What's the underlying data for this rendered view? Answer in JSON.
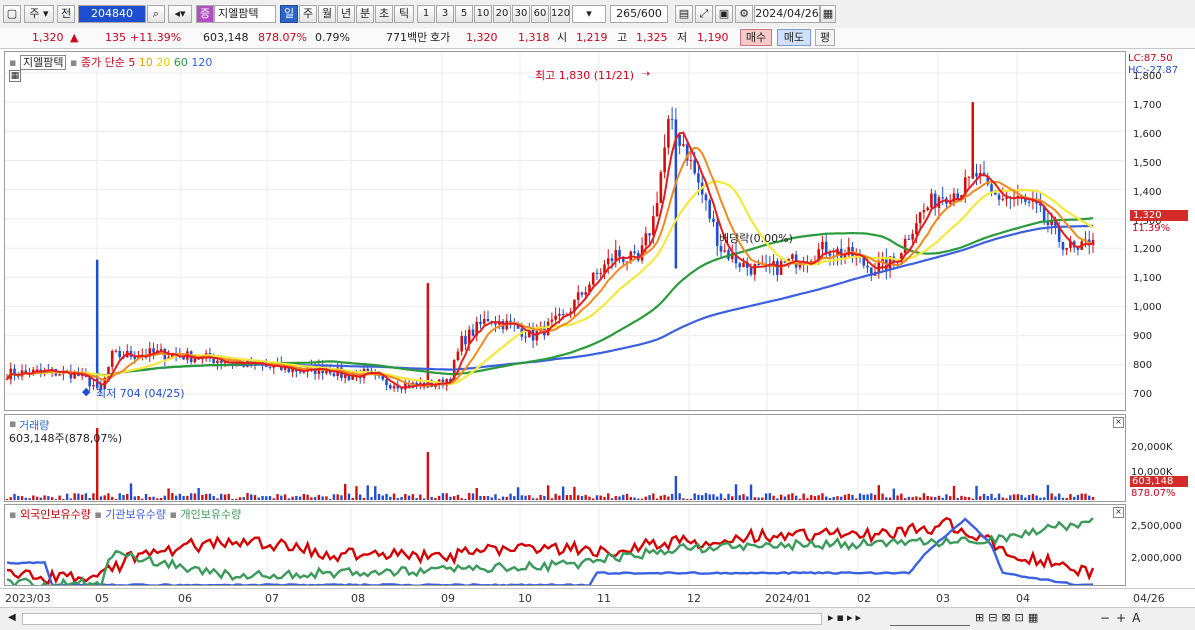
{
  "toolbar": {
    "market_label": "주",
    "side_label": "전",
    "code": "204840",
    "stock_badge": "증",
    "stock_name": "지엘팜텍",
    "period_buttons": [
      "일",
      "주",
      "월",
      "년",
      "분",
      "초",
      "틱"
    ],
    "interval_buttons": [
      "1",
      "3",
      "5",
      "10",
      "20",
      "30",
      "60",
      "120"
    ],
    "count_value": "265",
    "count_total": "/600",
    "date_value": "2024/04/26"
  },
  "info": {
    "price": "1,320",
    "change": "135",
    "change_pct": "+11.39%",
    "volume": "603,148",
    "volume_pct": "878.07%",
    "turnover": "0.79%",
    "amount": "771백만",
    "quote_label": "호가",
    "ask": "1,320",
    "bid": "1,318",
    "open_label": "시",
    "open": "1,219",
    "high_label": "고",
    "high": "1,325",
    "low_label": "저",
    "low": "1,190",
    "buy_label": "매수",
    "sell_label": "매도",
    "eval_label": "평"
  },
  "main_legend": {
    "stock": "지엘팜텍",
    "ma_title": "종가 단순",
    "ma_5": "5",
    "ma_10": "10",
    "ma_20": "20",
    "ma_60": "60",
    "ma_120": "120"
  },
  "annotations": {
    "high": "최고 1,830 (11/21)",
    "low": "최저 704 (04/25)",
    "dividend": "배당락(0.00%)",
    "lc": "LC:87.50",
    "hc": "HC:-27.87",
    "last_price": "1,320",
    "last_pct": "11.39%"
  },
  "volume_panel": {
    "title": "거래량",
    "value": "603,148주(878,07%)",
    "tag_value": "603,148",
    "tag_pct": "878.07%",
    "ticks": [
      "20,000K",
      "10,000K"
    ]
  },
  "hold_panel": {
    "foreign": "외국인보유수량",
    "inst": "기관보유수량",
    "indiv": "개인보유수량",
    "ticks": [
      "2,500,000",
      "2,000,000"
    ]
  },
  "price_ticks": [
    "1,800",
    "1,700",
    "1,600",
    "1,500",
    "1,400",
    "1,300",
    "1,200",
    "1,100",
    "1,000",
    "900",
    "800",
    "700"
  ],
  "x_labels": [
    "2023/03",
    "05",
    "06",
    "07",
    "08",
    "09",
    "10",
    "11",
    "12",
    "2024/01",
    "02",
    "03",
    "04",
    "04/26"
  ],
  "colors": {
    "ma5": "#e41e1e",
    "ma10": "#f08a1e",
    "ma20": "#f5e83c",
    "ma60": "#2a9a3a",
    "ma120": "#3a60e0",
    "up": "#d01010",
    "down": "#1f4fd0",
    "foreign": "#d40000",
    "inst": "#3a60e0",
    "indiv": "#3a9a5a"
  }
}
